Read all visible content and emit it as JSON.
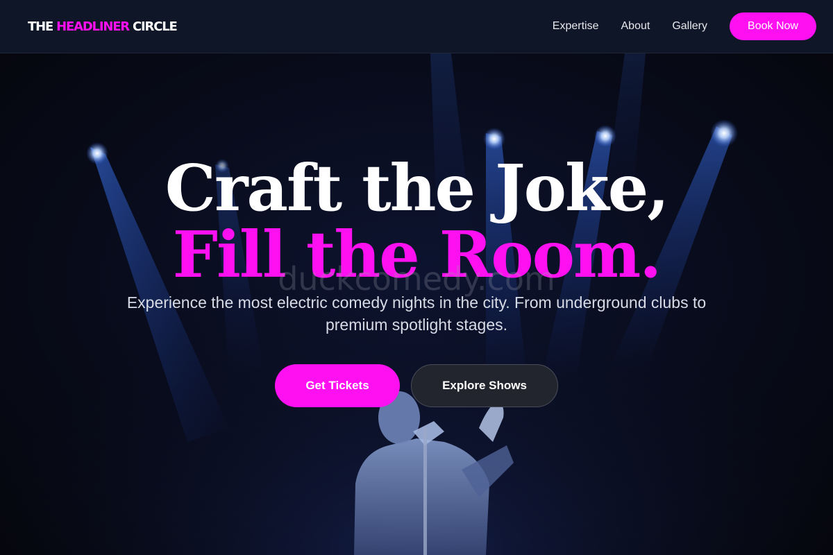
{
  "nav": {
    "logo_part1": "THE",
    "logo_part2": "HEADLINER",
    "logo_part3": "CIRCLE",
    "links": [
      "Expertise",
      "About",
      "Gallery"
    ],
    "cta_label": "Book Now"
  },
  "hero": {
    "headline_line1": "Craft the Joke,",
    "headline_line2": "Fill the Room.",
    "watermark": "duckcomedy.com",
    "subtitle": "Experience the most electric comedy nights in the city. From underground clubs to premium spotlight stages.",
    "primary_cta": "Get Tickets",
    "secondary_cta": "Explore Shows"
  },
  "colors": {
    "accent": "#ff10f0",
    "nav_bg": "#0f1627",
    "hero_bg": "#080b1a",
    "secondary_button_bg": "#23252e"
  }
}
